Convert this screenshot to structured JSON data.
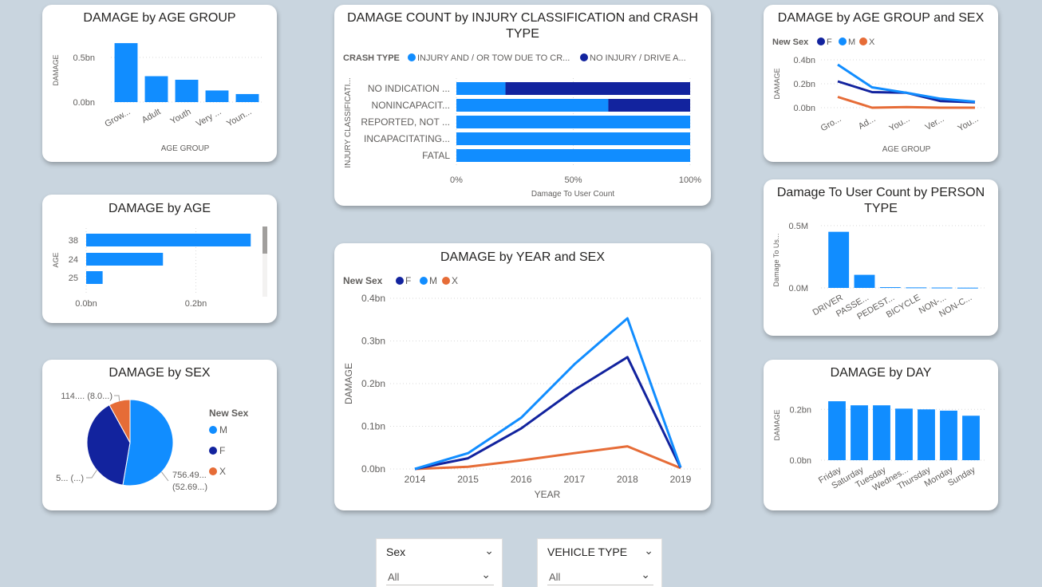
{
  "colors": {
    "m": "#118dff",
    "f": "#12239e",
    "x": "#e66c37",
    "grid": "#d9d9d9"
  },
  "age_group_card": {
    "title": "DAMAGE by AGE GROUP"
  },
  "age_card": {
    "title": "DAMAGE by AGE"
  },
  "sex_card": {
    "title": "DAMAGE by SEX"
  },
  "injury_card": {
    "title_line1": "DAMAGE COUNT by INJURY CLASSIFICATION and CRASH",
    "title_line2": "TYPE"
  },
  "year_card": {
    "title": "DAMAGE by YEAR and SEX"
  },
  "age_sex_card": {
    "title": "DAMAGE by AGE GROUP and SEX"
  },
  "person_card": {
    "title_line1": "Damage To User Count by PERSON",
    "title_line2": "TYPE"
  },
  "day_card": {
    "title": "DAMAGE by DAY"
  },
  "slicers": [
    {
      "label": "Sex",
      "value": "All"
    },
    {
      "label": "VEHICLE TYPE",
      "value": "All"
    }
  ],
  "chart_data": [
    {
      "id": "age_group",
      "type": "bar",
      "title": "DAMAGE by AGE GROUP",
      "xlabel": "AGE GROUP",
      "ylabel": "DAMAGE",
      "categories": [
        "Grow...",
        "Adult",
        "Youth",
        "Very ...",
        "Youn..."
      ],
      "category_full_count": 5,
      "values": [
        0.66,
        0.29,
        0.25,
        0.13,
        0.09
      ],
      "unit": "bn",
      "yticks": [
        "0.0bn",
        "0.5bn"
      ],
      "ylim": [
        0,
        0.75
      ],
      "grid": true
    },
    {
      "id": "age",
      "type": "bar",
      "orientation": "horizontal",
      "title": "DAMAGE by AGE",
      "ylabel": "AGE",
      "categories": [
        "38",
        "24",
        "25"
      ],
      "values": [
        0.3,
        0.14,
        0.03
      ],
      "unit": "bn",
      "xticks": [
        "0.0bn",
        "0.2bn"
      ],
      "xlim": [
        0,
        0.32
      ],
      "grid": true
    },
    {
      "id": "sex",
      "type": "pie",
      "title": "DAMAGE by SEX",
      "legend_title": "New Sex",
      "legend_position": "right",
      "categories": [
        "M",
        "F",
        "X"
      ],
      "values": [
        52.69,
        39.31,
        8.0
      ],
      "data_labels": [
        {
          "line1": "756.49...",
          "line2": "(52.69...)"
        },
        {
          "line1": "5... (...)",
          "line2": ""
        },
        {
          "line1": "114.... (8.0...)",
          "line2": ""
        }
      ]
    },
    {
      "id": "injury",
      "type": "bar",
      "orientation": "horizontal",
      "stacked": "100%",
      "title": "DAMAGE COUNT by INJURY CLASSIFICATION and CRASH TYPE",
      "xlabel": "Damage To User Count",
      "ylabel": "INJURY CLASSIFICATI...",
      "legend_title": "CRASH TYPE",
      "legend_position": "top",
      "categories": [
        "NO INDICATION ...",
        "NONINCAPACIT...",
        "REPORTED, NOT ...",
        "INCAPACITATING...",
        "FATAL"
      ],
      "series": [
        {
          "name": "INJURY AND / OR TOW DUE TO CR...",
          "values": [
            21,
            65,
            100,
            100,
            100
          ]
        },
        {
          "name": "NO INJURY / DRIVE A...",
          "values": [
            79,
            35,
            0,
            0,
            0
          ]
        }
      ],
      "xticks": [
        "0%",
        "50%",
        "100%"
      ]
    },
    {
      "id": "year_sex",
      "type": "line",
      "title": "DAMAGE by YEAR and SEX",
      "xlabel": "YEAR",
      "ylabel": "DAMAGE",
      "legend_title": "New Sex",
      "legend_position": "top-left",
      "x": [
        "2014",
        "2015",
        "2016",
        "2017",
        "2018",
        "2019"
      ],
      "series": [
        {
          "name": "F",
          "values": [
            0.0,
            0.025,
            0.095,
            0.185,
            0.262,
            0.003
          ]
        },
        {
          "name": "M",
          "values": [
            0.0,
            0.037,
            0.12,
            0.245,
            0.353,
            0.004
          ]
        },
        {
          "name": "X",
          "values": [
            0.0,
            0.005,
            0.02,
            0.037,
            0.053,
            0.002
          ]
        }
      ],
      "unit": "bn",
      "yticks": [
        "0.0bn",
        "0.1bn",
        "0.2bn",
        "0.3bn",
        "0.4bn"
      ],
      "ylim": [
        0,
        0.4
      ],
      "grid": true
    },
    {
      "id": "age_group_sex",
      "type": "line",
      "title": "DAMAGE by AGE GROUP and SEX",
      "xlabel": "AGE GROUP",
      "ylabel": "DAMAGE",
      "legend_title": "New Sex",
      "legend_position": "top-left",
      "x": [
        "Gro...",
        "Ad...",
        "You...",
        "Ver...",
        "You..."
      ],
      "series": [
        {
          "name": "F",
          "values": [
            0.22,
            0.13,
            0.125,
            0.055,
            0.045
          ]
        },
        {
          "name": "M",
          "values": [
            0.36,
            0.17,
            0.125,
            0.075,
            0.05
          ]
        },
        {
          "name": "X",
          "values": [
            0.09,
            0.0,
            0.005,
            0.0,
            0.0
          ]
        }
      ],
      "unit": "bn",
      "yticks": [
        "0.0bn",
        "0.2bn",
        "0.4bn"
      ],
      "ylim": [
        0,
        0.4
      ],
      "grid": true
    },
    {
      "id": "person_type",
      "type": "bar",
      "title": "Damage To User Count by PERSON TYPE",
      "ylabel": "Damage To Us...",
      "categories": [
        "DRIVER",
        "PASSE...",
        "PEDEST...",
        "BICYCLE",
        "NON-...",
        "NON-C..."
      ],
      "values": [
        0.45,
        0.105,
        0.006,
        0.004,
        0.003,
        0.002
      ],
      "unit": "M",
      "yticks": [
        "0.0M",
        "0.5M"
      ],
      "ylim": [
        0,
        0.55
      ],
      "grid": true
    },
    {
      "id": "day",
      "type": "bar",
      "title": "DAMAGE by DAY",
      "ylabel": "DAMAGE",
      "categories": [
        "Friday",
        "Saturday",
        "Tuesday",
        "Wednes...",
        "Thursday",
        "Monday",
        "Sunday"
      ],
      "values": [
        0.232,
        0.216,
        0.216,
        0.203,
        0.2,
        0.195,
        0.175
      ],
      "unit": "bn",
      "yticks": [
        "0.0bn",
        "0.2bn"
      ],
      "ylim": [
        0,
        0.27
      ],
      "grid": true
    }
  ]
}
